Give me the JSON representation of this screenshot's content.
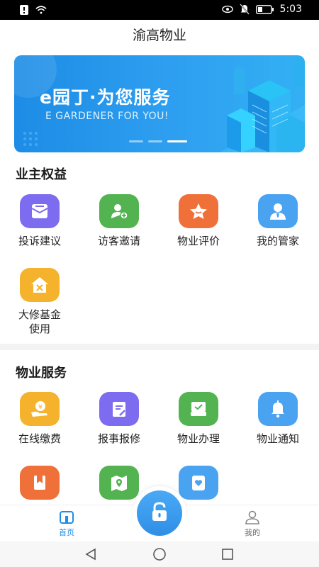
{
  "status_bar": {
    "time": "5:03"
  },
  "header": {
    "title": "渝高物业"
  },
  "banner": {
    "title": "e园丁·为您服务",
    "subtitle": "E GARDENER FOR YOU!",
    "page_count": 3,
    "active_page": 3
  },
  "owner_rights": {
    "title": "业主权益",
    "items": [
      {
        "label": "投诉建议",
        "icon": "complaint-icon",
        "color": "#7d6cf0"
      },
      {
        "label": "访客邀请",
        "icon": "visitor-icon",
        "color": "#52b350"
      },
      {
        "label": "物业评价",
        "icon": "rating-star-icon",
        "color": "#f0703a"
      },
      {
        "label": "我的管家",
        "icon": "butler-icon",
        "color": "#4aa3f0"
      },
      {
        "label": "大修基金\n使用",
        "icon": "repair-fund-icon",
        "color": "#f5b32d"
      }
    ]
  },
  "property_services": {
    "title": "物业服务",
    "items": [
      {
        "label": "在线缴费",
        "icon": "payment-icon",
        "color": "#f5b32d"
      },
      {
        "label": "报事报修",
        "icon": "report-repair-icon",
        "color": "#7d6cf0"
      },
      {
        "label": "物业办理",
        "icon": "property-handle-icon",
        "color": "#52b350"
      },
      {
        "label": "物业通知",
        "icon": "notice-bell-icon",
        "color": "#4aa3f0"
      },
      {
        "label": "",
        "icon": "bookmark-icon",
        "color": "#f0703a"
      },
      {
        "label": "",
        "icon": "map-location-icon",
        "color": "#52b350"
      },
      {
        "label": "",
        "icon": "heart-card-icon",
        "color": "#4aa3f0"
      }
    ]
  },
  "bottom_nav": {
    "home_label": "首页",
    "mine_label": "我的"
  },
  "colors": {
    "accent": "#1e8ee6"
  }
}
